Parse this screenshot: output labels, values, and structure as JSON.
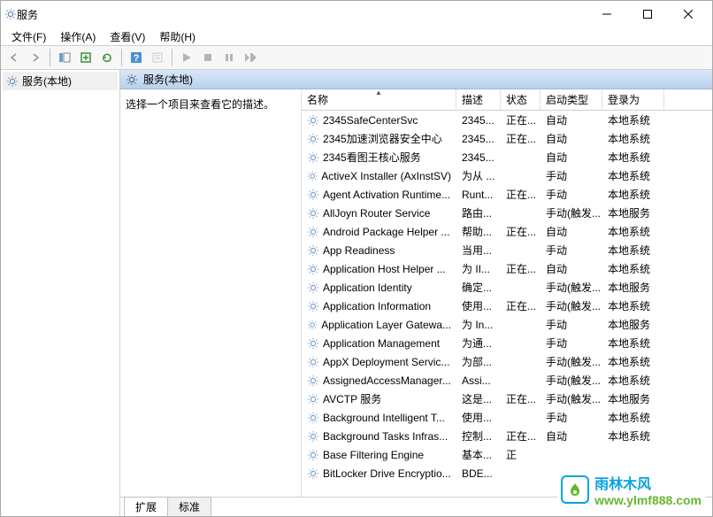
{
  "window": {
    "title": "服务"
  },
  "menu": {
    "file": "文件(F)",
    "action": "操作(A)",
    "view": "查看(V)",
    "help": "帮助(H)"
  },
  "tree": {
    "root": "服务(本地)"
  },
  "rightHeader": "服务(本地)",
  "descPanel": "选择一个项目来查看它的描述。",
  "columns": {
    "name": "名称",
    "desc": "描述",
    "status": "状态",
    "startup": "启动类型",
    "logon": "登录为"
  },
  "services": [
    {
      "name": "2345SafeCenterSvc",
      "desc": "2345...",
      "status": "正在...",
      "startup": "自动",
      "logon": "本地系统"
    },
    {
      "name": "2345加速浏览器安全中心",
      "desc": "2345...",
      "status": "正在...",
      "startup": "自动",
      "logon": "本地系统"
    },
    {
      "name": "2345看图王核心服务",
      "desc": "2345...",
      "status": "",
      "startup": "自动",
      "logon": "本地系统"
    },
    {
      "name": "ActiveX Installer (AxInstSV)",
      "desc": "为从 ...",
      "status": "",
      "startup": "手动",
      "logon": "本地系统"
    },
    {
      "name": "Agent Activation Runtime...",
      "desc": "Runt...",
      "status": "正在...",
      "startup": "手动",
      "logon": "本地系统"
    },
    {
      "name": "AllJoyn Router Service",
      "desc": "路由...",
      "status": "",
      "startup": "手动(触发...",
      "logon": "本地服务"
    },
    {
      "name": "Android Package Helper ...",
      "desc": "帮助...",
      "status": "正在...",
      "startup": "自动",
      "logon": "本地系统"
    },
    {
      "name": "App Readiness",
      "desc": "当用...",
      "status": "",
      "startup": "手动",
      "logon": "本地系统"
    },
    {
      "name": "Application Host Helper ...",
      "desc": "为 II...",
      "status": "正在...",
      "startup": "自动",
      "logon": "本地系统"
    },
    {
      "name": "Application Identity",
      "desc": "确定...",
      "status": "",
      "startup": "手动(触发...",
      "logon": "本地服务"
    },
    {
      "name": "Application Information",
      "desc": "使用...",
      "status": "正在...",
      "startup": "手动(触发...",
      "logon": "本地系统"
    },
    {
      "name": "Application Layer Gatewa...",
      "desc": "为 In...",
      "status": "",
      "startup": "手动",
      "logon": "本地服务"
    },
    {
      "name": "Application Management",
      "desc": "为通...",
      "status": "",
      "startup": "手动",
      "logon": "本地系统"
    },
    {
      "name": "AppX Deployment Servic...",
      "desc": "为部...",
      "status": "",
      "startup": "手动(触发...",
      "logon": "本地系统"
    },
    {
      "name": "AssignedAccessManager...",
      "desc": "Assi...",
      "status": "",
      "startup": "手动(触发...",
      "logon": "本地系统"
    },
    {
      "name": "AVCTP 服务",
      "desc": "这是...",
      "status": "正在...",
      "startup": "手动(触发...",
      "logon": "本地服务"
    },
    {
      "name": "Background Intelligent T...",
      "desc": "使用...",
      "status": "",
      "startup": "手动",
      "logon": "本地系统"
    },
    {
      "name": "Background Tasks Infras...",
      "desc": "控制...",
      "status": "正在...",
      "startup": "自动",
      "logon": "本地系统"
    },
    {
      "name": "Base Filtering Engine",
      "desc": "基本...",
      "status": "正",
      "startup": "",
      "logon": ""
    },
    {
      "name": "BitLocker Drive Encryptio...",
      "desc": "BDE...",
      "status": "",
      "startup": "",
      "logon": ""
    }
  ],
  "tabs": {
    "extended": "扩展",
    "standard": "标准"
  },
  "watermark": {
    "text1": "雨林木风",
    "text2": "www.ylmf888.com"
  }
}
